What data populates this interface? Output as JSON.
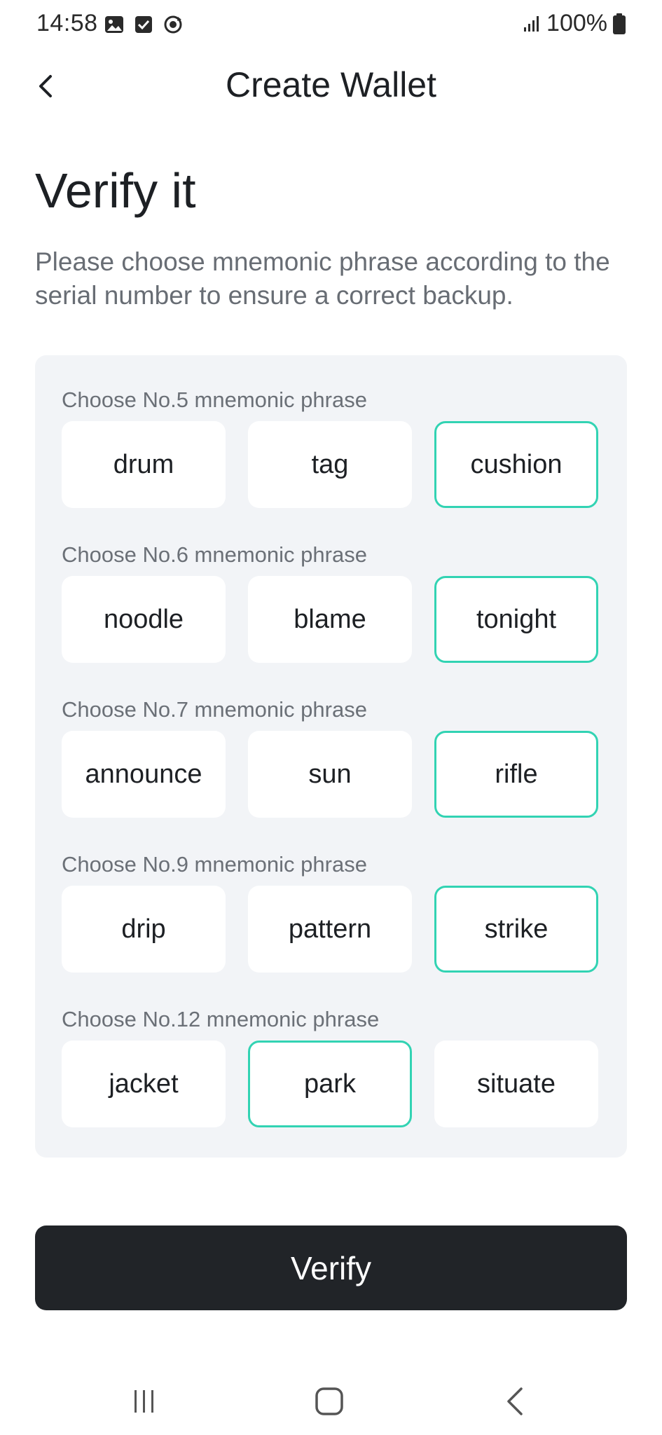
{
  "status_bar": {
    "time": "14:58",
    "icons": [
      "gallery-icon",
      "checkbox-icon",
      "sync-icon"
    ],
    "battery": "100%"
  },
  "header": {
    "title": "Create Wallet"
  },
  "headline": "Verify it",
  "subtitle": "Please choose mnemonic phrase according to the serial number to ensure a correct backup.",
  "groups": [
    {
      "label": "Choose No.5 mnemonic phrase",
      "options": [
        "drum",
        "tag",
        "cushion"
      ],
      "selected": 2
    },
    {
      "label": "Choose No.6 mnemonic phrase",
      "options": [
        "noodle",
        "blame",
        "tonight"
      ],
      "selected": 2
    },
    {
      "label": "Choose No.7 mnemonic phrase",
      "options": [
        "announce",
        "sun",
        "rifle"
      ],
      "selected": 2
    },
    {
      "label": "Choose No.9 mnemonic phrase",
      "options": [
        "drip",
        "pattern",
        "strike"
      ],
      "selected": 2
    },
    {
      "label": "Choose No.12 mnemonic phrase",
      "options": [
        "jacket",
        "park",
        "situate"
      ],
      "selected": 1
    }
  ],
  "verify_button": {
    "label": "Verify"
  },
  "colors": {
    "accent": "#32d3b3",
    "button_bg": "#212428",
    "panel_bg": "#f2f4f7"
  }
}
